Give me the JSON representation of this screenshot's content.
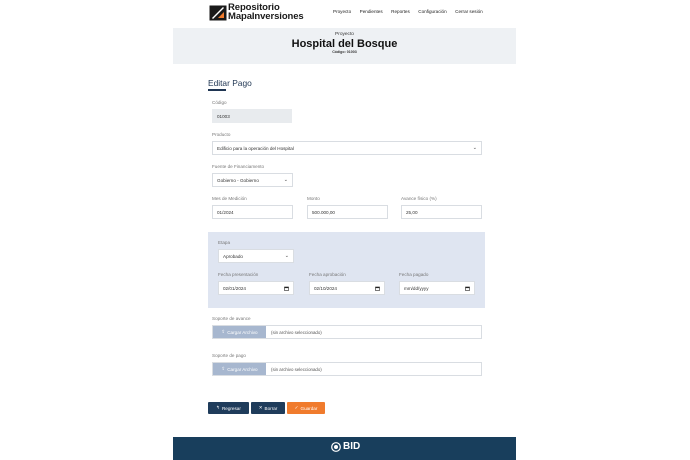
{
  "header": {
    "logo_line1": "Repositorio",
    "logo_line2": "MapaInversiones",
    "nav": [
      "Proyecto",
      "Pendientes",
      "Reportes",
      "Configuración",
      "Cerrar sesión"
    ]
  },
  "project": {
    "label": "Proyecto",
    "title": "Hospital del Bosque",
    "code": "Código: 01003"
  },
  "form": {
    "title": "Editar Pago",
    "codigo_label": "Código",
    "codigo_value": "01003",
    "producto_label": "Producto",
    "producto_value": "Edificio para la operación del Hospital",
    "fuente_label": "Fuente de Financiamento",
    "fuente_value": "Gobierno - Gobierno",
    "mes_label": "Mes de Medición",
    "mes_value": "01/2024",
    "monto_label": "Monto",
    "monto_value": "500.000,00",
    "avance_label": "Avance físico (%)",
    "avance_value": "25,00",
    "etapa_label": "Etapa",
    "etapa_value": "Aprobado",
    "fecha_presentacion_label": "Fecha presentación",
    "fecha_presentacion_value": "02/01/2024",
    "fecha_aprobacion_label": "Fecha aprobación",
    "fecha_aprobacion_value": "02/10/2024",
    "fecha_pagado_label": "Fecha pagado",
    "fecha_pagado_value": "mm/dd/yyyy",
    "soporte_avance_label": "Soporte de avance",
    "soporte_pago_label": "Soporte de pago",
    "upload_label": "Cargar Archivo",
    "no_file": "(sin archivo seleccionado)"
  },
  "buttons": {
    "back": "Regresar",
    "delete": "Borrar",
    "save": "Guardar"
  },
  "footer": {
    "logo": "BID"
  },
  "colors": {
    "navy": "#1f3c5b",
    "orange": "#f07b2d",
    "stage_bg": "#dfe5f1",
    "footer": "#183e5c"
  }
}
